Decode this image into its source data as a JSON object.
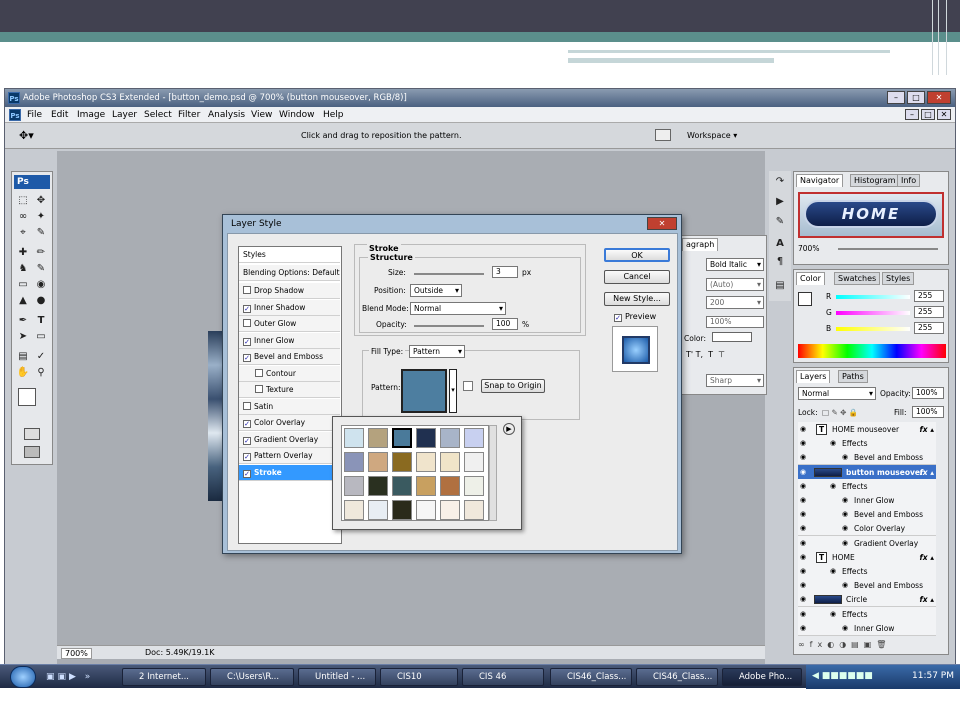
{
  "window": {
    "title": "Adobe Photoshop CS3 Extended - [button_demo.psd @ 700% (button mouseover, RGB/8)]"
  },
  "menu": [
    "File",
    "Edit",
    "Image",
    "Layer",
    "Select",
    "Filter",
    "Analysis",
    "View",
    "Window",
    "Help"
  ],
  "options": {
    "hint": "Click and drag to reposition the pattern.",
    "workspace": "Workspace"
  },
  "status": {
    "zoom": "700%",
    "doc": "Doc: 5.49K/19.1K"
  },
  "toolbox": {
    "logo": "Ps"
  },
  "dialog": {
    "title": "Layer Style",
    "styles_header": "Styles",
    "blending": "Blending Options: Default",
    "effects": [
      {
        "label": "Drop Shadow",
        "checked": false
      },
      {
        "label": "Inner Shadow",
        "checked": true
      },
      {
        "label": "Outer Glow",
        "checked": false
      },
      {
        "label": "Inner Glow",
        "checked": true
      },
      {
        "label": "Bevel and Emboss",
        "checked": true
      },
      {
        "label": "Contour",
        "checked": false,
        "sub": true
      },
      {
        "label": "Texture",
        "checked": false,
        "sub": true
      },
      {
        "label": "Satin",
        "checked": false
      },
      {
        "label": "Color Overlay",
        "checked": true
      },
      {
        "label": "Gradient Overlay",
        "checked": true
      },
      {
        "label": "Pattern Overlay",
        "checked": true
      },
      {
        "label": "Stroke",
        "checked": true,
        "selected": true
      }
    ],
    "stroke_title": "Stroke",
    "structure_title": "Structure",
    "size_label": "Size:",
    "size_value": "3",
    "size_unit": "px",
    "position_label": "Position:",
    "position_value": "Outside",
    "blend_label": "Blend Mode:",
    "blend_value": "Normal",
    "opacity_label": "Opacity:",
    "opacity_value": "100",
    "opacity_unit": "%",
    "fill_label": "Fill Type:",
    "fill_value": "Pattern",
    "pattern_label": "Pattern:",
    "snap_button": "Snap to Origin",
    "ok": "OK",
    "cancel": "Cancel",
    "new_style": "New Style...",
    "preview": "Preview",
    "pattern_colors": [
      "#cfe3ee",
      "#b4a27e",
      "#4a7a9a",
      "#203050",
      "#a8b4c8",
      "#c8d0f0",
      "#8a94b8",
      "#cfa880",
      "#8a6a20",
      "#f0e4cc",
      "#f0e4c8",
      "#f0f0f0",
      "#b8b8c0",
      "#2a3020",
      "#3a5a60",
      "#c8a060",
      "#b07040",
      "#eef0e8",
      "#efe8dc",
      "#e8eef4",
      "#2a2a1a",
      "#f6f6f6",
      "#f8f0e8",
      "#f0e8dc"
    ]
  },
  "char_panel": {
    "tab": "agraph",
    "font_style": "Bold Italic",
    "leading": "(Auto)",
    "tracking": "200",
    "scale": "100%",
    "color_label": "Color:",
    "aa": "Sharp"
  },
  "navigator": {
    "tabs": [
      "Navigator",
      "Histogram",
      "Info"
    ],
    "preview_text": "HOME",
    "zoom": "700%"
  },
  "color": {
    "tabs": [
      "Color",
      "Swatches",
      "Styles"
    ],
    "r": "255",
    "g": "255",
    "b": "255",
    "r_label": "R",
    "g_label": "G",
    "b_label": "B"
  },
  "layers": {
    "tabs": [
      "Layers",
      "Paths"
    ],
    "mode": "Normal",
    "opacity_label": "Opacity:",
    "opacity": "100%",
    "lock_label": "Lock:",
    "fill_label": "Fill:",
    "fill": "100%",
    "rows": [
      {
        "label": "HOME mouseover",
        "kind": "text",
        "indent": 0,
        "fx": true
      },
      {
        "label": "Effects",
        "kind": "effects",
        "indent": 1
      },
      {
        "label": "Bevel and Emboss",
        "kind": "effect",
        "indent": 2
      },
      {
        "label": "button mouseover",
        "kind": "shape",
        "indent": 0,
        "fx": true,
        "selected": true
      },
      {
        "label": "Effects",
        "kind": "effects",
        "indent": 1
      },
      {
        "label": "Inner Glow",
        "kind": "effect",
        "indent": 2
      },
      {
        "label": "Bevel and Emboss",
        "kind": "effect",
        "indent": 2
      },
      {
        "label": "Color Overlay",
        "kind": "effect",
        "indent": 2
      },
      {
        "label": "Gradient Overlay",
        "kind": "effect",
        "indent": 2
      },
      {
        "label": "HOME",
        "kind": "text",
        "indent": 0,
        "fx": true
      },
      {
        "label": "Effects",
        "kind": "effects",
        "indent": 1
      },
      {
        "label": "Bevel and Emboss",
        "kind": "effect",
        "indent": 2
      },
      {
        "label": "Circle",
        "kind": "shape",
        "indent": 0,
        "fx": true
      },
      {
        "label": "Effects",
        "kind": "effects",
        "indent": 1
      },
      {
        "label": "Inner Glow",
        "kind": "effect",
        "indent": 2
      }
    ]
  },
  "taskbar": {
    "items": [
      "2 Internet...",
      "C:\\Users\\R...",
      "Untitled - ...",
      "CIS10",
      "CIS 46",
      "CIS46_Class...",
      "CIS46_Class...",
      "Adobe Pho..."
    ],
    "clock": "11:57 PM"
  }
}
